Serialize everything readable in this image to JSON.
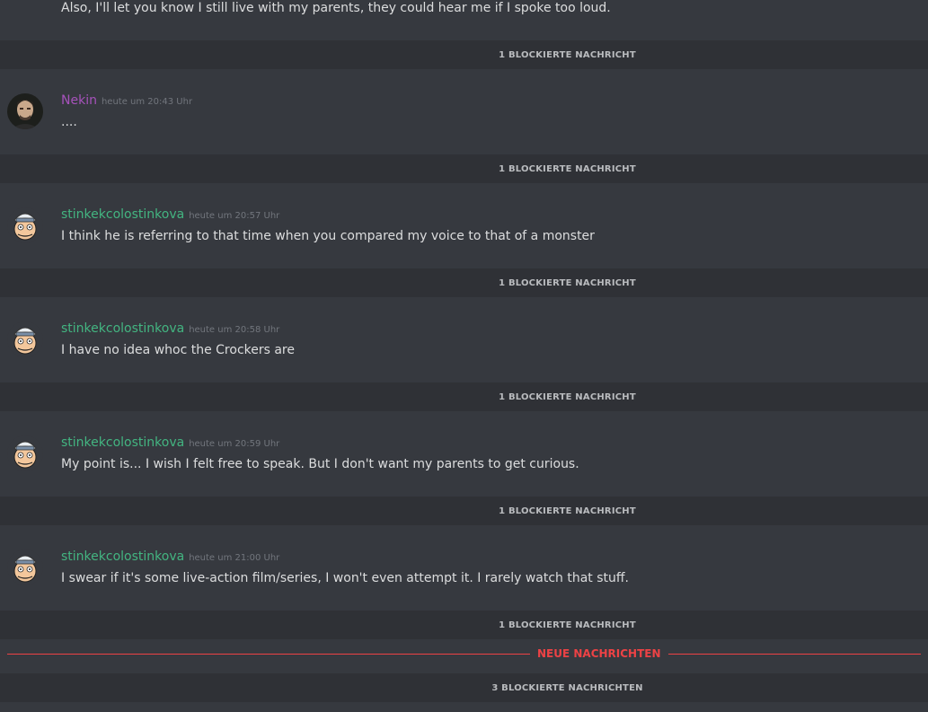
{
  "top_message": "Also, I'll let you know I still live with my parents, they could hear me if I spoke too loud.",
  "blocked": [
    "1 BLOCKIERTE NACHRICHT",
    "1 BLOCKIERTE NACHRICHT",
    "1 BLOCKIERTE NACHRICHT",
    "1 BLOCKIERTE NACHRICHT",
    "1 BLOCKIERTE NACHRICHT",
    "1 BLOCKIERTE NACHRICHT",
    "3 BLOCKIERTE NACHRICHTEN"
  ],
  "messages": [
    {
      "username": "Nekin",
      "username_color": "#a652bb",
      "timestamp": "heute um 20:43 Uhr",
      "text": "...."
    },
    {
      "username": "stinkekcolostinkova",
      "username_color": "#43b581",
      "timestamp": "heute um 20:57 Uhr",
      "text": "I think he is referring to that time when you compared my voice to that of a monster"
    },
    {
      "username": "stinkekcolostinkova",
      "username_color": "#43b581",
      "timestamp": "heute um 20:58 Uhr",
      "text": "I have no idea whoc the Crockers are"
    },
    {
      "username": "stinkekcolostinkova",
      "username_color": "#43b581",
      "timestamp": "heute um 20:59 Uhr",
      "text": "My point is... I wish I felt free to speak. But I don't want my parents to get curious."
    },
    {
      "username": "stinkekcolostinkova",
      "username_color": "#43b581",
      "timestamp": "heute um 21:00 Uhr",
      "text": "I swear if it's some live-action film/series, I won't even attempt it. I rarely watch that stuff."
    }
  ],
  "new_messages_divider": "NEUE NACHRICHTEN",
  "colors": {
    "background": "#36393f",
    "blocked_bar": "#2f3136",
    "new_divider": "#ed4245",
    "nekin": "#a652bb",
    "stinkek": "#43b581"
  }
}
